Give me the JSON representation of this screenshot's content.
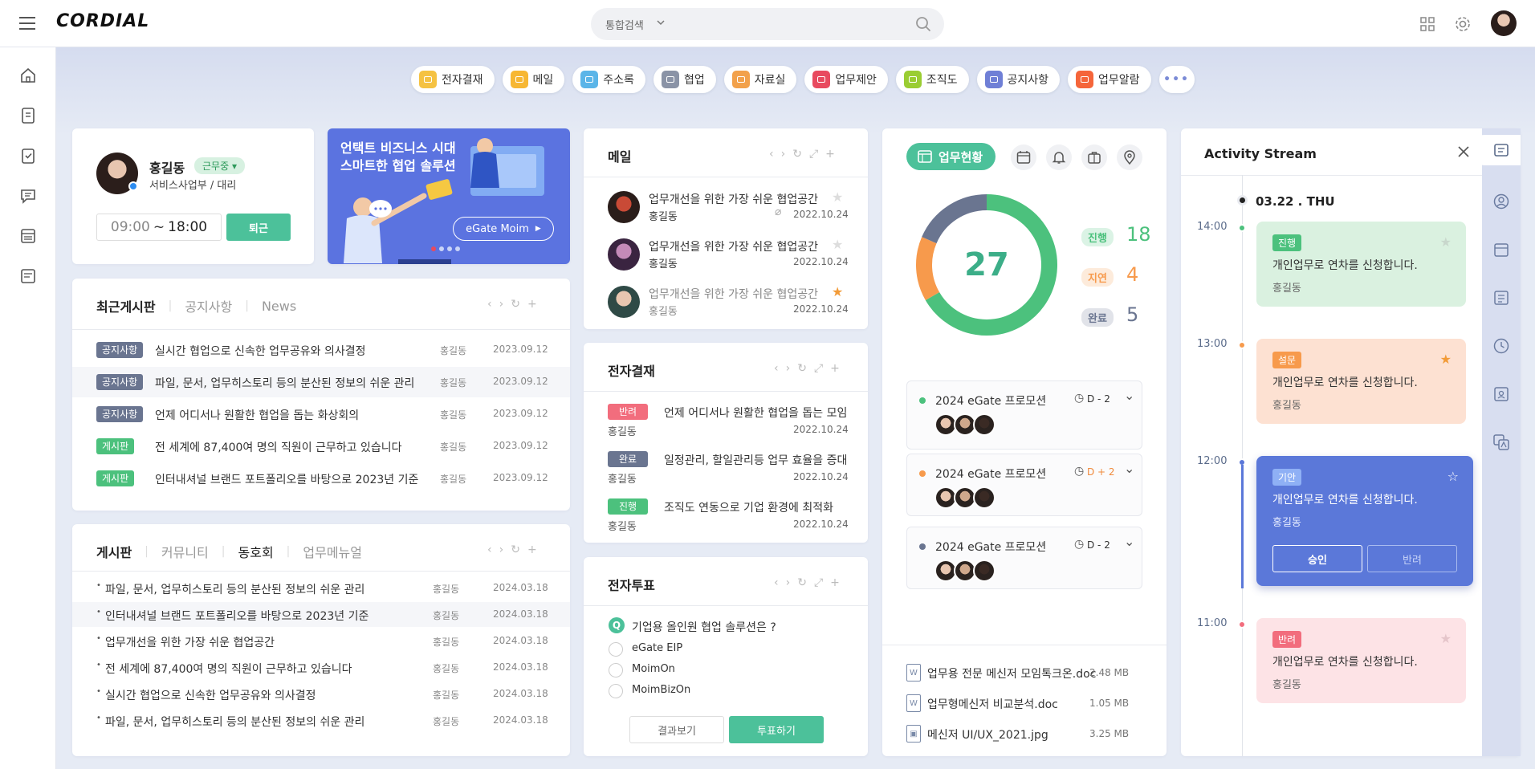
{
  "brand": {
    "logo": "CORDIAL"
  },
  "search": {
    "scope": "통합검색",
    "placeholder": ""
  },
  "shortcuts": [
    {
      "label": "전자결재",
      "icon": "approval-icon",
      "color": "#f5c242"
    },
    {
      "label": "메일",
      "icon": "mail-icon",
      "color": "#f7b733"
    },
    {
      "label": "주소록",
      "icon": "contacts-icon",
      "color": "#5bb5e8"
    },
    {
      "label": "협업",
      "icon": "collaboration-icon",
      "color": "#8a93a6"
    },
    {
      "label": "자료실",
      "icon": "archive-icon",
      "color": "#f2a14b"
    },
    {
      "label": "업무제안",
      "icon": "proposal-icon",
      "color": "#e84a5f"
    },
    {
      "label": "조직도",
      "icon": "org-chart-icon",
      "color": "#9acd32"
    },
    {
      "label": "공지사항",
      "icon": "notice-icon",
      "color": "#6f7fd6"
    },
    {
      "label": "업무알람",
      "icon": "alarm-icon",
      "color": "#f5653a"
    }
  ],
  "profile": {
    "name": "홍길동",
    "status": "근무중",
    "dept": "서비스사업부 / 대리",
    "time_start": "09:00",
    "time_sep": "~",
    "time_end": "18:00",
    "checkout": "퇴근"
  },
  "promo": {
    "line1": "언택트 비즈니스 시대",
    "line2": "스마트한 협업 솔루션",
    "button": "eGate Moim"
  },
  "board1": {
    "tabs": [
      "최근게시판",
      "공지사항",
      "News"
    ],
    "rows": [
      {
        "tag": "공지사항",
        "title": "실시간 협업으로 신속한 업무공유와 의사결정",
        "author": "홍길동",
        "date": "2023.09.12"
      },
      {
        "tag": "공지사항",
        "title": "파일, 문서, 업무히스토리 등의 분산된 정보의 쉬운 관리",
        "author": "홍길동",
        "date": "2023.09.12"
      },
      {
        "tag": "공지사항",
        "title": "언제 어디서나 원활한 협업을 돕는 화상회의",
        "author": "홍길동",
        "date": "2023.09.12"
      },
      {
        "tag": "게시판",
        "title": "전 세계에 87,400여 명의 직원이 근무하고 있습니다",
        "author": "홍길동",
        "date": "2023.09.12"
      },
      {
        "tag": "게시판",
        "title": "인터내셔널 브랜드 포트폴리오를 바탕으로 2023년 기준",
        "author": "홍길동",
        "date": "2023.09.12"
      }
    ]
  },
  "board2": {
    "tabs": [
      "게시판",
      "커뮤니티",
      "동호회",
      "업무메뉴얼"
    ],
    "rows": [
      {
        "title": "파일, 문서, 업무히스토리 등의 분산된 정보의 쉬운 관리",
        "author": "홍길동",
        "date": "2024.03.18"
      },
      {
        "title": "인터내셔널 브랜드 포트폴리오를 바탕으로 2023년 기준",
        "author": "홍길동",
        "date": "2024.03.18"
      },
      {
        "title": "업무개선을 위한 가장 쉬운 협업공간",
        "author": "홍길동",
        "date": "2024.03.18"
      },
      {
        "title": "전 세계에 87,400여 명의 직원이 근무하고 있습니다",
        "author": "홍길동",
        "date": "2024.03.18"
      },
      {
        "title": "실시간 협업으로 신속한 업무공유와 의사결정",
        "author": "홍길동",
        "date": "2024.03.18"
      },
      {
        "title": "파일, 문서, 업무히스토리 등의 분산된 정보의 쉬운 관리",
        "author": "홍길동",
        "date": "2024.03.18"
      }
    ]
  },
  "mail": {
    "title": "메일",
    "items": [
      {
        "subject": "업무개선을 위한 가장 쉬운 협업공간",
        "sender": "홍길동",
        "date": "2022.10.24"
      },
      {
        "subject": "업무개선을 위한 가장 쉬운 협업공간",
        "sender": "홍길동",
        "date": "2022.10.24"
      },
      {
        "subject": "업무개선을 위한 가장 쉬운 협업공간",
        "sender": "홍길동",
        "date": "2022.10.24"
      }
    ]
  },
  "approval": {
    "title": "전자결재",
    "items": [
      {
        "tag": "반려",
        "color": "#f26d7d",
        "title": "언제 어디서나 원활한 협업을 돕는 모임",
        "user": "홍길동",
        "date": "2022.10.24"
      },
      {
        "tag": "완료",
        "color": "#6a7590",
        "title": "일정관리, 할일관리등 업무 효율을 증대",
        "user": "홍길동",
        "date": "2022.10.24"
      },
      {
        "tag": "진행",
        "color": "#4cc17d",
        "title": "조직도 연동으로 기업 환경에 최적화",
        "user": "홍길동",
        "date": "2022.10.24"
      }
    ]
  },
  "vote": {
    "title": "전자투표",
    "q": "Q",
    "question": "기업용 올인원 협업 솔루션은 ?",
    "options": [
      "eGate EIP",
      "MoimOn",
      "MoimBizOn"
    ],
    "result_button": "결과보기",
    "vote_button": "투표하기"
  },
  "status": {
    "tab": "업무현황",
    "total": "27",
    "stats": [
      {
        "label": "진행",
        "value": 18,
        "color": "#4cc17d"
      },
      {
        "label": "지연",
        "value": 4,
        "color": "#f79a4c"
      },
      {
        "label": "완료",
        "value": 5,
        "color": "#6a7590"
      }
    ],
    "projects": [
      {
        "name": "2024 eGate 프로모션",
        "dday": "D - 2",
        "dot": "#4cc17d",
        "ddcolor": "#333"
      },
      {
        "name": "2024 eGate 프로모션",
        "dday": "D + 2",
        "dot": "#f79a4c",
        "ddcolor": "#f08a3c"
      },
      {
        "name": "2024 eGate 프로모션",
        "dday": "D - 2",
        "dot": "#6a7590",
        "ddcolor": "#333"
      }
    ],
    "files": [
      {
        "name": "업무용 전문 메신저 모임톡크온.doc",
        "size": "2.48 MB"
      },
      {
        "name": "업무형메신저 비교분석.doc",
        "size": "1.05 MB"
      },
      {
        "name": "메신저 UI/UX_2021.jpg",
        "size": "3.25 MB"
      }
    ]
  },
  "activity": {
    "title": "Activity Stream",
    "date": "03.22 . THU",
    "items": [
      {
        "time": "14:00",
        "tag": "진행",
        "msg": "개인업무로 연차를 신청합니다.",
        "user": "홍길동"
      },
      {
        "time": "13:00",
        "tag": "설문",
        "msg": "개인업무로 연차를 신청합니다.",
        "user": "홍길동"
      },
      {
        "time": "12:00",
        "tag": "기안",
        "msg": "개인업무로 연차를 신청합니다.",
        "user": "홍길동",
        "approve": "승인",
        "reject": "반려"
      },
      {
        "time": "11:00",
        "tag": "반려",
        "msg": "개인업무로 연차를 신청합니다.",
        "user": "홍길동"
      }
    ]
  }
}
